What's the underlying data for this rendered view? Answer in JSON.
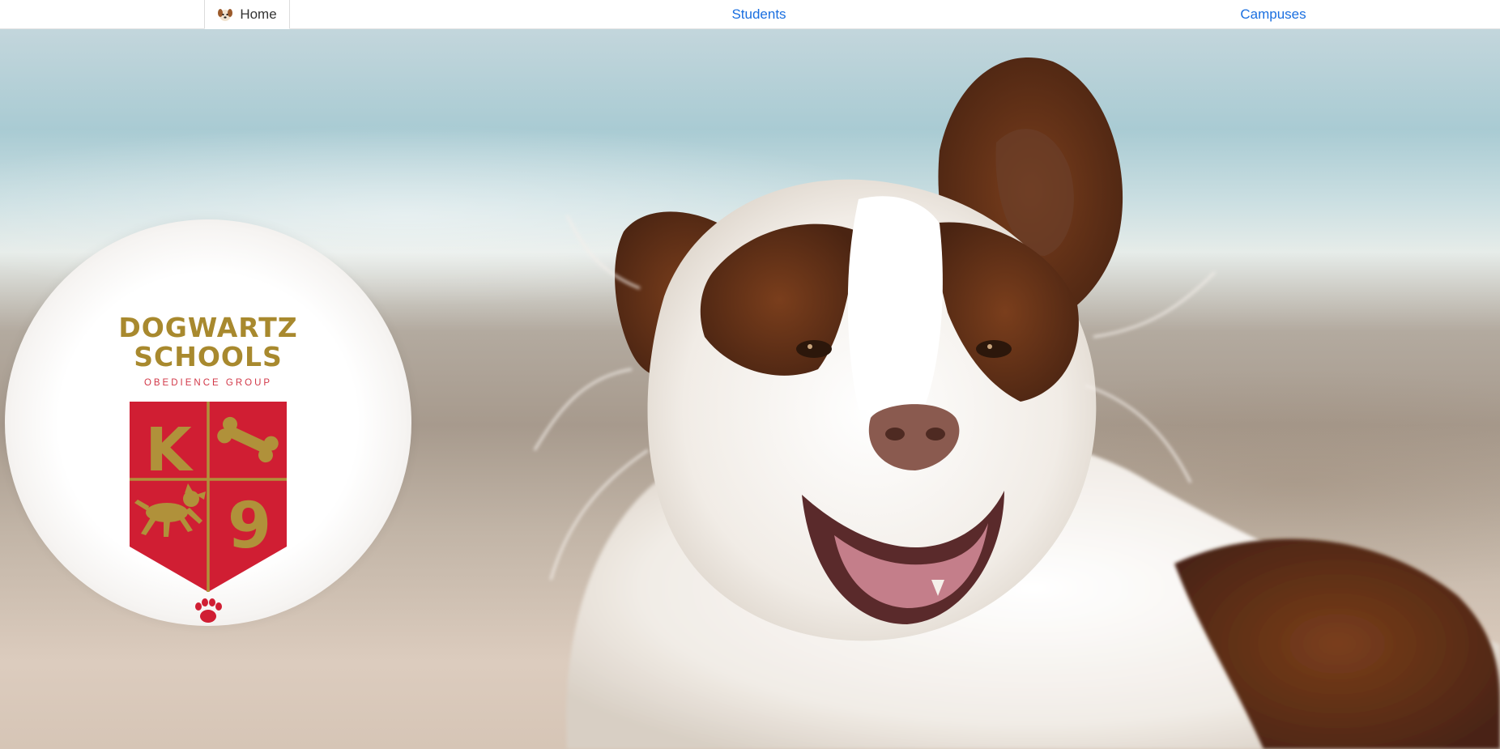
{
  "nav": {
    "home_label": "Home",
    "students_label": "Students",
    "campuses_label": "Campuses",
    "home_icon": "dog-face-icon",
    "link_color": "#1a6fe0"
  },
  "logo": {
    "line1": "DOGWARTZ",
    "line2": "SCHOOLS",
    "subtitle": "OBEDIENCE GROUP",
    "crest_letters": [
      "K",
      "9"
    ],
    "crest_color": "#d01e33",
    "gold_color": "#a8892e",
    "paw_icon": "paw-icon",
    "bone_icon": "bone-icon",
    "running-dog_icon": "running-dog-icon"
  },
  "hero": {
    "image": "dog-photo"
  }
}
